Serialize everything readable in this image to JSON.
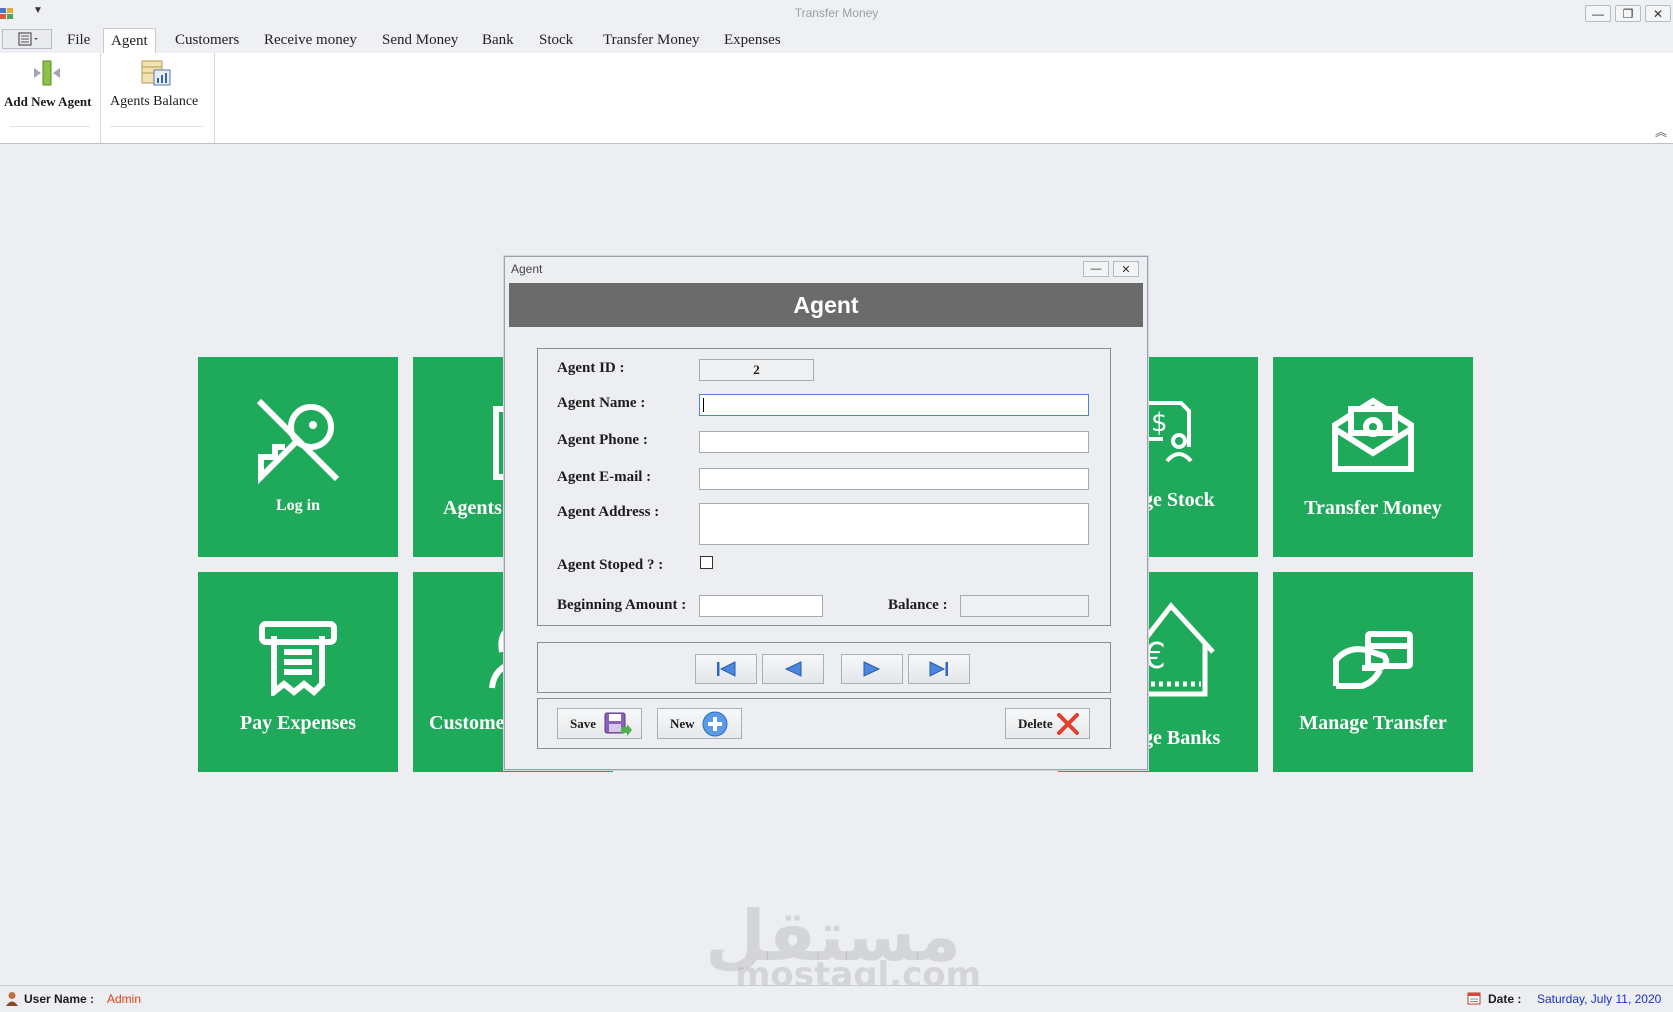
{
  "window": {
    "title": "Transfer Money"
  },
  "ribbon": {
    "tabs": [
      "File",
      "Agent",
      "Customers",
      "Receive money",
      "Send Money",
      "Bank",
      "Stock",
      "Transfer Money",
      "Expenses"
    ],
    "active_tab": "Agent",
    "buttons": {
      "add_new_agent": "Add  New Agent",
      "agents_balance": "Agents Balance"
    }
  },
  "tiles": {
    "login": "Log in",
    "agents": "Agents",
    "manage_stock": "ge Stock",
    "transfer_money": "Transfer Money",
    "pay_expenses": "Pay Expenses",
    "customers": "Custome",
    "manage_banks": "ge Banks",
    "manage_transfer": "Manage Transfer"
  },
  "dialog": {
    "window_title": "Agent",
    "header": "Agent",
    "fields": {
      "agent_id_label": "Agent ID :",
      "agent_id_value": "2",
      "agent_name_label": "Agent Name :",
      "agent_phone_label": "Agent Phone :",
      "agent_email_label": "Agent E-mail :",
      "agent_address_label": "Agent Address :",
      "agent_stoped_label": "Agent Stoped ? :",
      "beginning_amount_label": "Beginning Amount :",
      "balance_label": "Balance :"
    },
    "buttons": {
      "save": "Save",
      "new": "New",
      "delete": "Delete"
    }
  },
  "status": {
    "user_label": "User Name :",
    "user_value": "Admin",
    "date_label": "Date :",
    "date_value": "Saturday, July 11, 2020"
  },
  "watermark": {
    "arabic": "مستقل",
    "latin": "mostaql.com"
  },
  "colors": {
    "tile": "#1eaa5a",
    "dialog_header": "#6b6b6b",
    "user_value": "#e0401a",
    "date_value": "#1a2fcf"
  }
}
